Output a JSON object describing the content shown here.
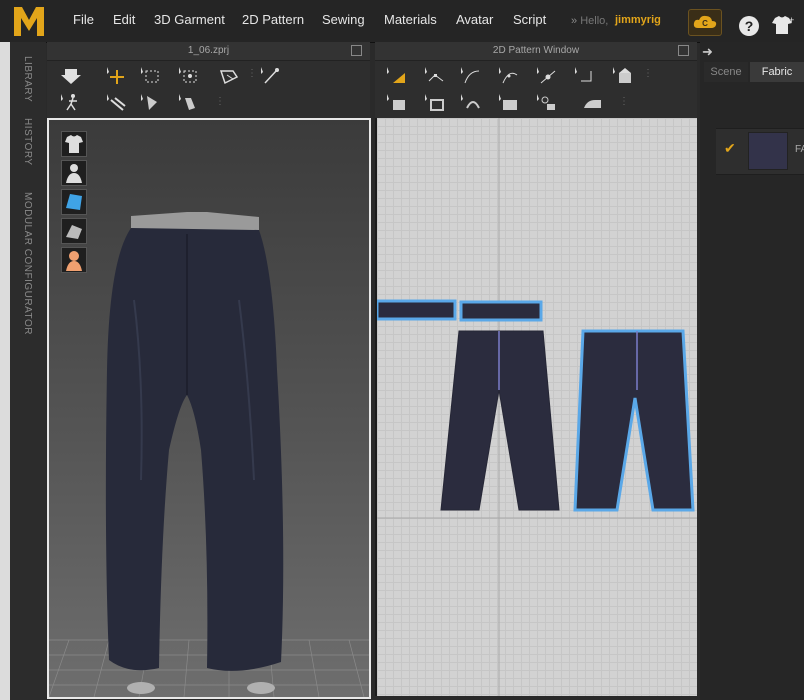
{
  "app": {
    "logo_letter": "M",
    "accent": "#e2a51a"
  },
  "menu": [
    "File",
    "Edit",
    "3D Garment",
    "2D Pattern",
    "Sewing",
    "Materials",
    "Avatar",
    "Script"
  ],
  "user": {
    "greeting": "Hello,",
    "name": "jimmyrig"
  },
  "side_tabs": [
    "LIBRARY",
    "HISTORY",
    "MODULAR CONFIGURATOR"
  ],
  "windows": {
    "garment3d": {
      "title": "1_06.zprj"
    },
    "pattern2d": {
      "title": "2D Pattern Window"
    }
  },
  "right_panel": {
    "tabs": [
      "Scene",
      "Fabric"
    ],
    "active_tab": "Fabric",
    "fabric_item_label": "FA",
    "fabric_color": "#33334a"
  },
  "icons": {
    "toolbar3d_row1": [
      "simulation-icon",
      "select-move-icon",
      "select-mesh-icon",
      "transform-icon",
      "fold-icon",
      "pin-icon"
    ],
    "toolbar3d_row2": [
      "avatar-pose-icon",
      "strengthen-icon",
      "tack-icon",
      "steam-icon"
    ],
    "toolbar2d_row1": [
      "transform-pattern-icon",
      "edit-point-icon",
      "curve-point-icon",
      "edit-curvature-icon",
      "add-point-icon",
      "polygon-icon",
      "fold-arrangement-icon"
    ],
    "toolbar2d_row2": [
      "segment-sewing-icon",
      "free-sewing-icon",
      "edit-sewing-icon",
      "sewing-machine-icon",
      "tack-2d-icon",
      "iron-icon"
    ]
  }
}
